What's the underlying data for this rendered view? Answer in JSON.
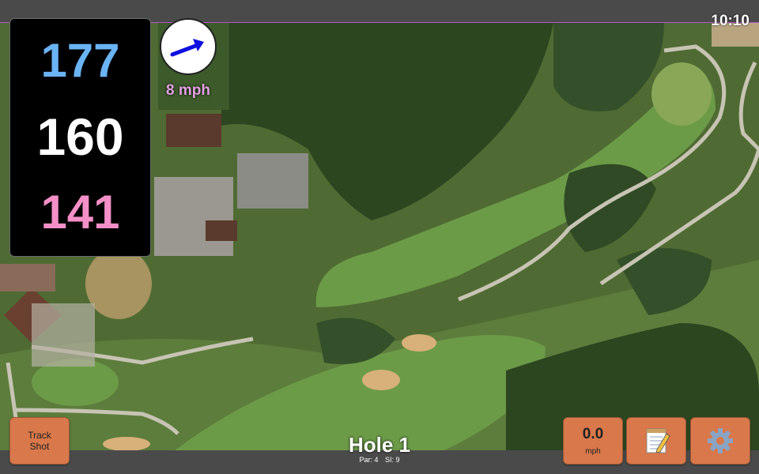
{
  "status": {
    "time": "10:10"
  },
  "distances": {
    "back": "177",
    "middle": "160",
    "front": "141",
    "colors": {
      "back": "#6ab4f5",
      "middle": "#ffffff",
      "front": "#f58fc8"
    }
  },
  "wind": {
    "speed": "8 mph",
    "direction_icon": "wind-direction-arrow-icon",
    "arrow_color": "#1010e0"
  },
  "buttons": {
    "track_shot_line1": "Track",
    "track_shot_line2": "Shot",
    "speed_value": "0.0",
    "speed_unit": "mph",
    "notes_icon": "notepad-icon",
    "settings_icon": "gear-icon",
    "tile_color": "#d9784a"
  },
  "hole": {
    "title": "Hole 1",
    "par": "Par: 4",
    "si": "SI: 9"
  },
  "colors": {
    "fairway": "#6c9b48",
    "rough": "#4f6b33",
    "trees": "#2c4620",
    "sand": "#d8b07a",
    "path": "#c8c4b4",
    "frame": "#4a4a4a",
    "accent": "#b357c7"
  }
}
